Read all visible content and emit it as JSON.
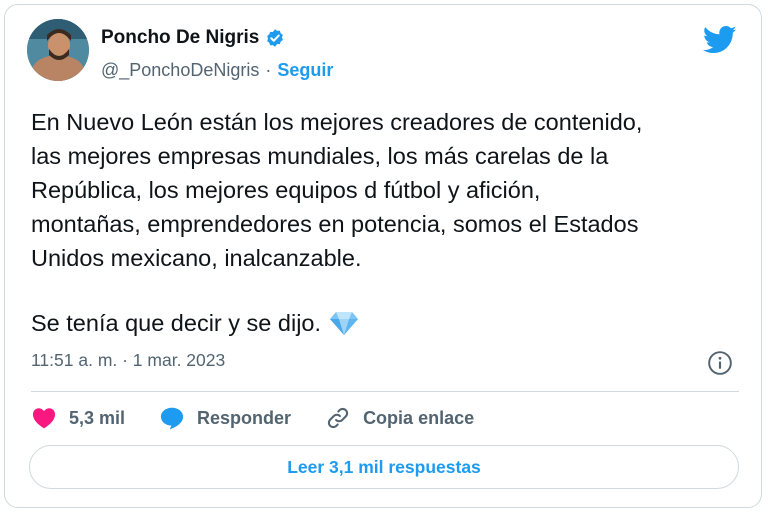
{
  "author": {
    "display_name": "Poncho De Nigris",
    "handle": "@_PonchoDeNigris",
    "separator": "·",
    "follow_label": "Seguir"
  },
  "tweet": {
    "body": "En Nuevo León están los mejores creadores de contenido,\nlas mejores empresas mundiales, los más carelas de la\nRepública, los mejores equipos d fútbol y afición,\nmontañas, emprendedores en potencia, somos el Estados\nUnidos mexicano, inalcanzable.",
    "closing": "Se tenía que decir y se dijo.",
    "timestamp": "11:51 a. m. · 1 mar. 2023"
  },
  "actions": {
    "likes_count": "5,3 mil",
    "reply_label": "Responder",
    "copy_link_label": "Copia enlace"
  },
  "read_replies_label": "Leer 3,1 mil respuestas",
  "colors": {
    "accent": "#1d9bf0",
    "like": "#f91880",
    "text": "#0f1419",
    "secondary": "#536471",
    "border": "#cfd9de"
  },
  "icons": [
    "verified-badge-icon",
    "twitter-bird-icon",
    "diamond-emoji-icon",
    "info-icon",
    "heart-icon",
    "reply-bubble-icon",
    "link-icon"
  ]
}
